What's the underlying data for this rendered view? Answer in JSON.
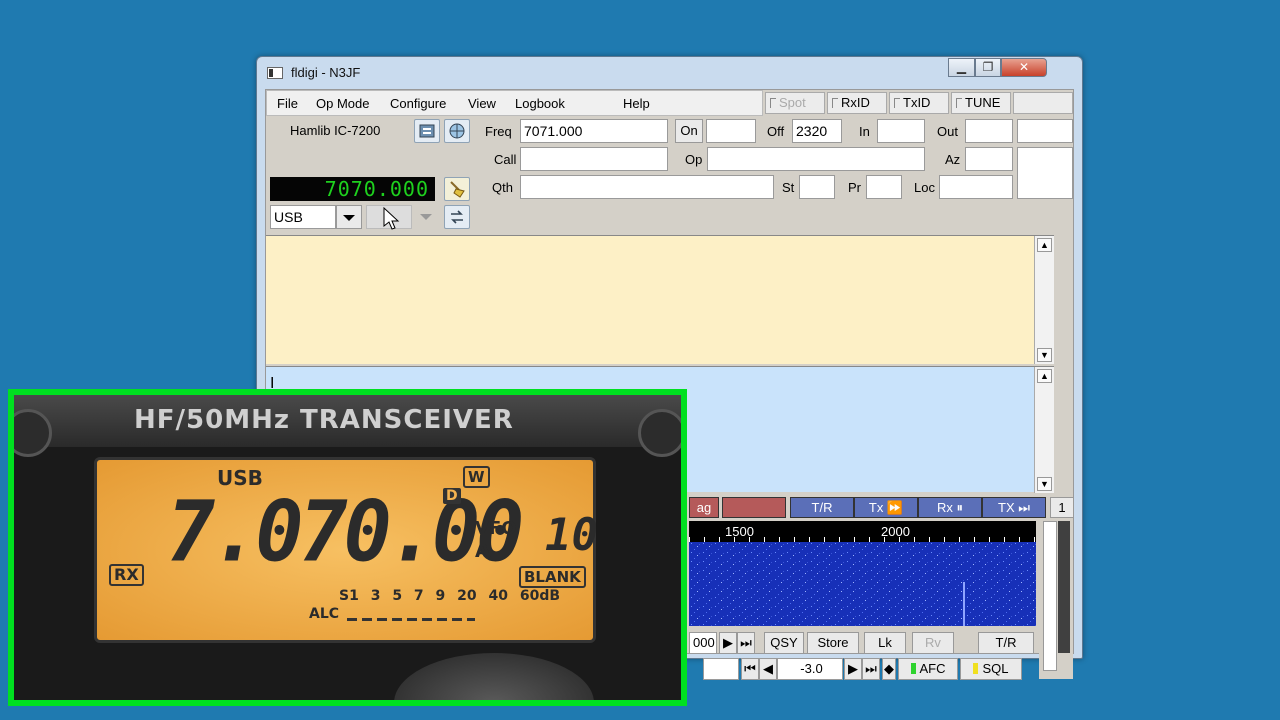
{
  "window": {
    "title": "fldigi - N3JF",
    "min": "▁",
    "max": "❐",
    "close": "✕"
  },
  "menu": {
    "file": "File",
    "opmode": "Op Mode",
    "configure": "Configure",
    "view": "View",
    "logbook": "Logbook",
    "help": "Help"
  },
  "toggles": {
    "spot": "Spot",
    "rxid": "RxID",
    "txid": "TxID",
    "tune": "TUNE"
  },
  "rig": {
    "name": "Hamlib IC-7200",
    "freq_display": "7070.000",
    "mode": "USB"
  },
  "log": {
    "freq_label": "Freq",
    "freq_value": "7071.000",
    "on_label": "On",
    "off_label": "Off",
    "off_value": "2320",
    "in_label": "In",
    "out_label": "Out",
    "call_label": "Call",
    "op_label": "Op",
    "az_label": "Az",
    "qth_label": "Qth",
    "st_label": "St",
    "pr_label": "Pr",
    "loc_label": "Loc"
  },
  "macros": {
    "m1": "ag",
    "tr": "T/R",
    "tx": "Tx ⏩",
    "rx": "Rx ⏸",
    "txb": "TX ⏭",
    "page": "1"
  },
  "scale": {
    "t1500": "1500",
    "t2000": "2000"
  },
  "controls": {
    "freq_partial": "000",
    "qsy": "QSY",
    "store": "Store",
    "lk": "Lk",
    "rv": "Rv",
    "tr": "T/R",
    "offset": "-3.0",
    "afc": "AFC",
    "sql": "SQL"
  },
  "radio": {
    "brand": "HF/50MHz TRANSCEIVER",
    "mode": "USB",
    "w_badge": "W",
    "freq": "7.070.00",
    "d_badge": "D",
    "vfo": "VFO",
    "vfo_sel": "A",
    "memory": "10",
    "rx_badge": "RX",
    "blank_badge": "BLANK",
    "meter_scale": "S1 3 5 7 9 20 40 60dB",
    "alc": "ALC"
  },
  "colors": {
    "accent": "#5b6fb8",
    "rx_bg": "#fdf0c6",
    "tx_bg": "#c9e3fb",
    "overlay_border": "#00e020"
  }
}
